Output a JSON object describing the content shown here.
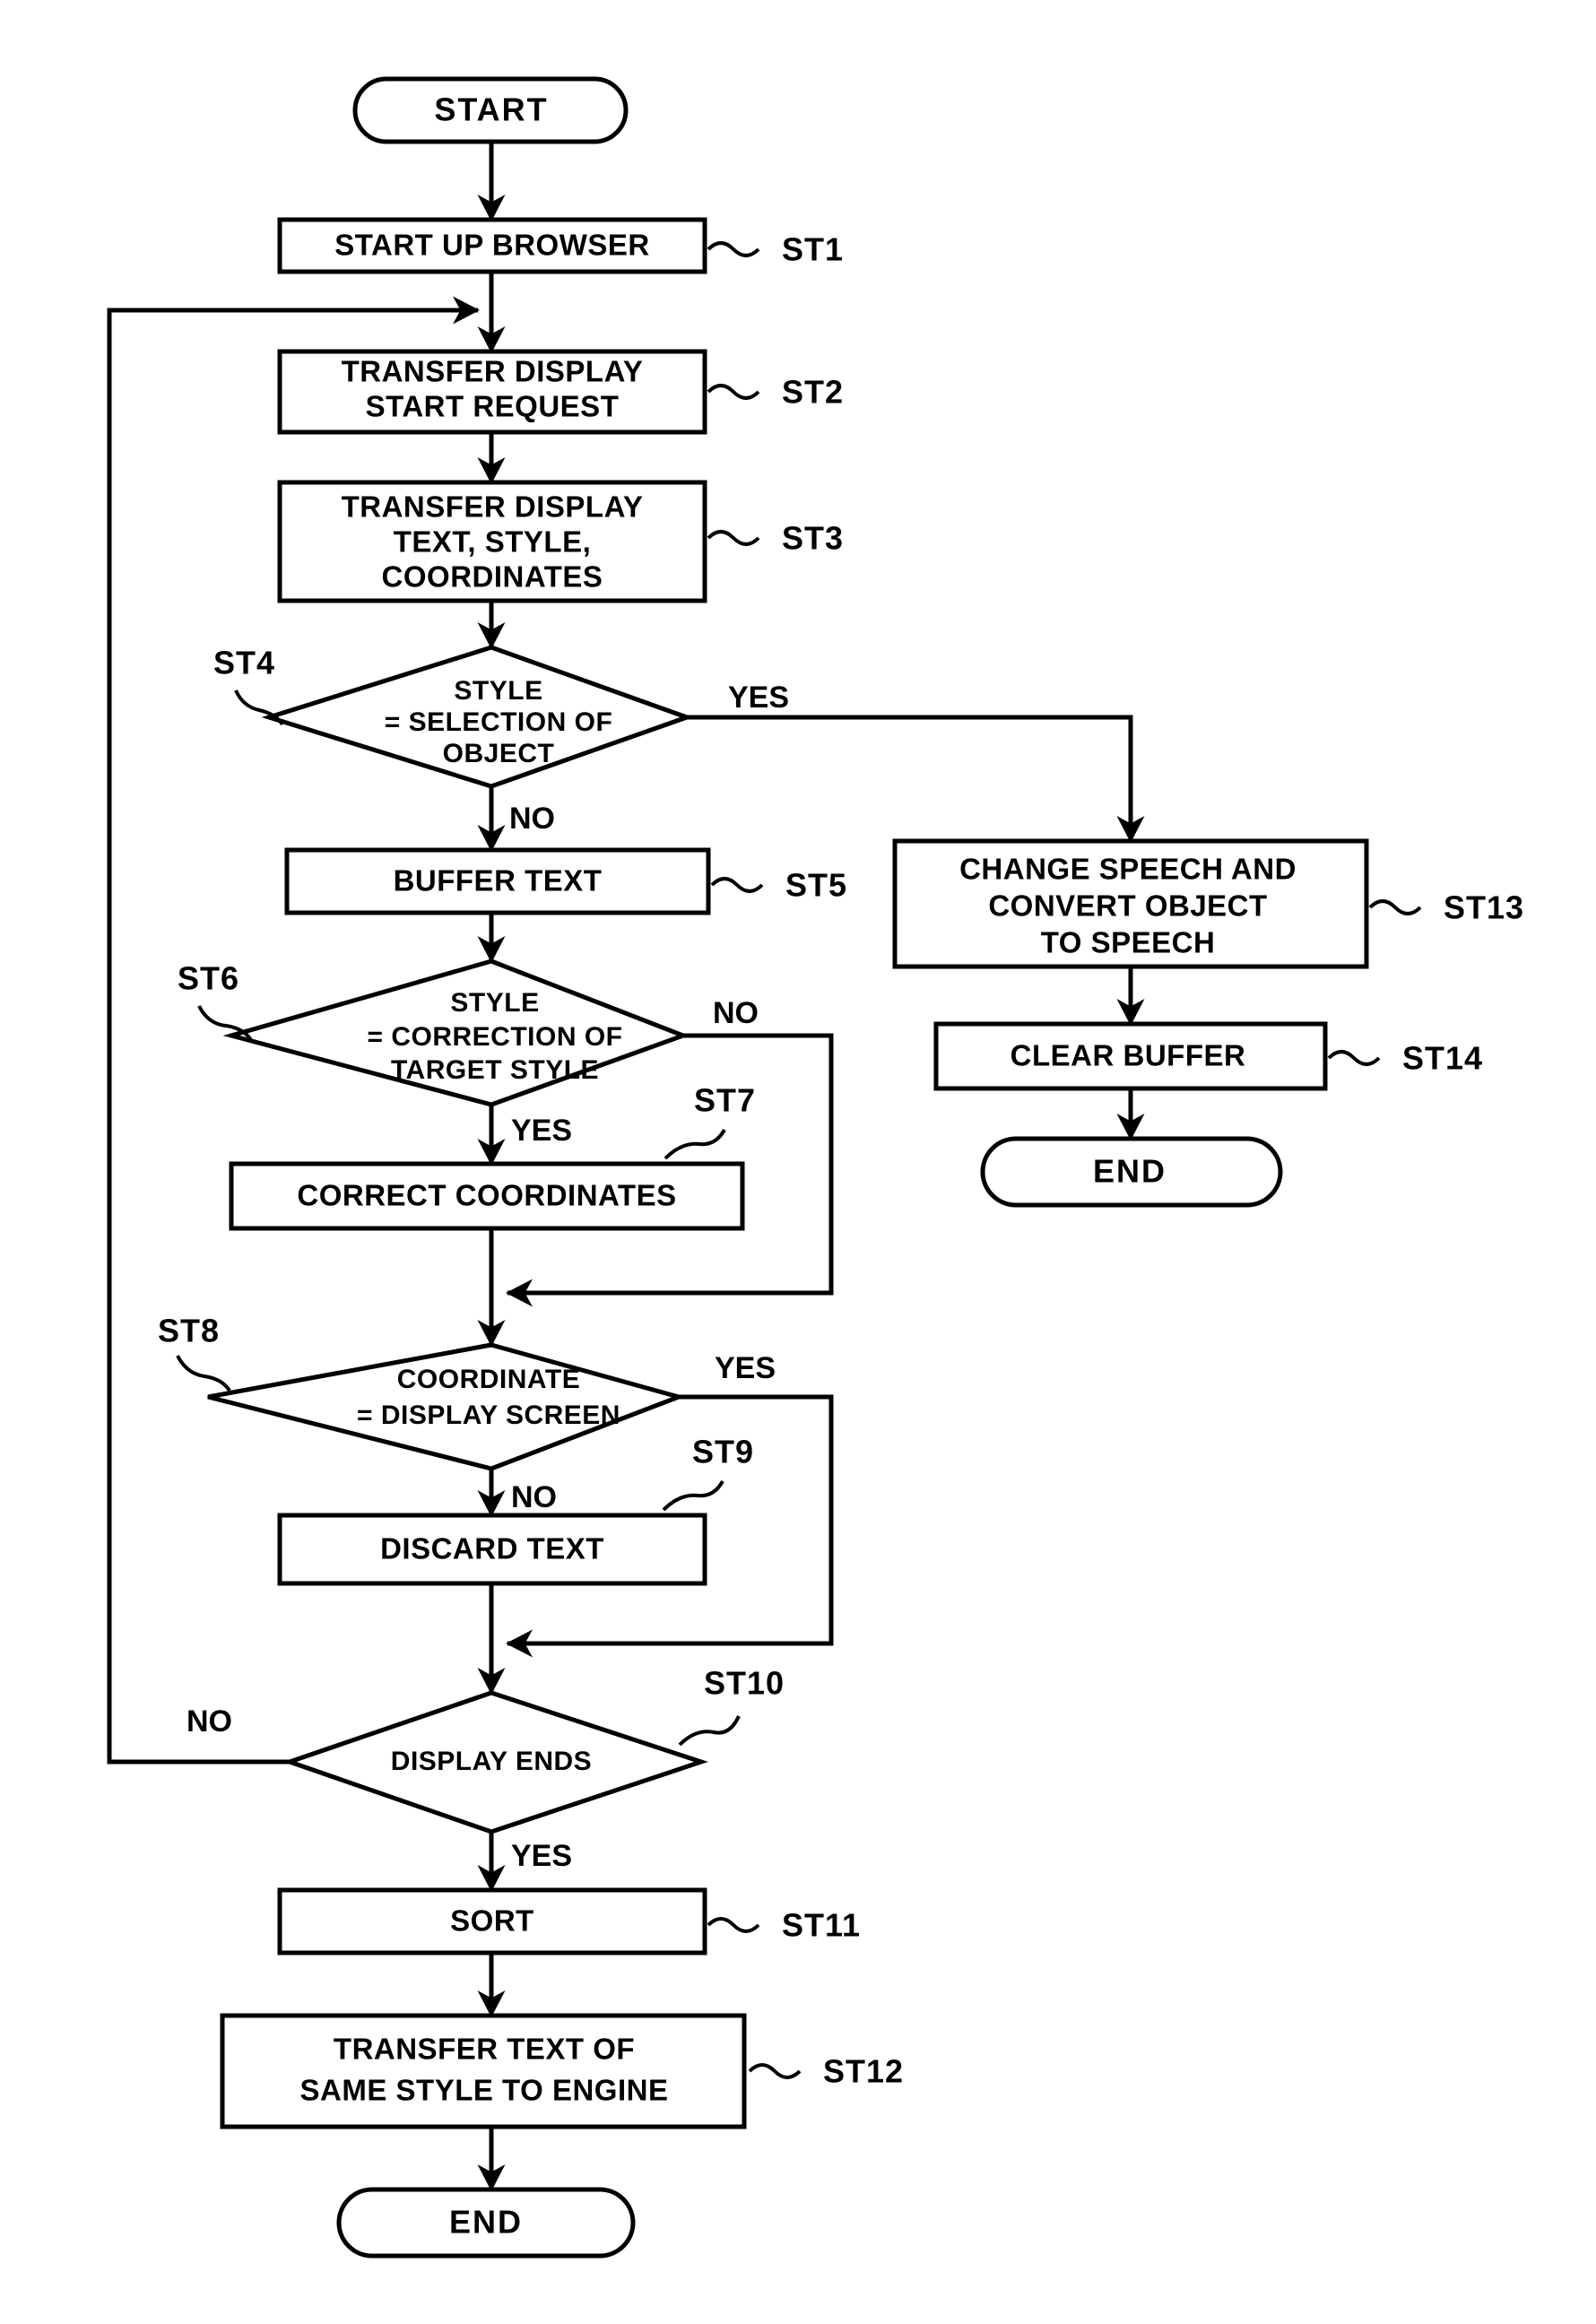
{
  "diagram": {
    "type": "flowchart",
    "orientation": "vertical",
    "terminals": {
      "start": "START",
      "end_main": "END",
      "end_branch": "END"
    },
    "branch_labels": {
      "yes": "YES",
      "no": "NO"
    },
    "nodes": [
      {
        "id": "start",
        "shape": "terminator",
        "text": "START",
        "step": ""
      },
      {
        "id": "st1",
        "shape": "process",
        "text": "START UP BROWSER",
        "step": "ST1"
      },
      {
        "id": "st2",
        "shape": "process",
        "line1": "TRANSFER DISPLAY",
        "line2": "START REQUEST",
        "step": "ST2"
      },
      {
        "id": "st3",
        "shape": "process",
        "line1": "TRANSFER DISPLAY",
        "line2": "TEXT, STYLE,",
        "line3": "COORDINATES",
        "step": "ST3"
      },
      {
        "id": "st4",
        "shape": "decision",
        "line1": "STYLE",
        "line2": "= SELECTION OF",
        "line3": "OBJECT",
        "step": "ST4",
        "yes_label": "YES",
        "no_label": "NO"
      },
      {
        "id": "st5",
        "shape": "process",
        "text": "BUFFER TEXT",
        "step": "ST5"
      },
      {
        "id": "st6",
        "shape": "decision",
        "line1": "STYLE",
        "line2": "= CORRECTION OF",
        "line3": "TARGET STYLE",
        "step": "ST6",
        "yes_label": "YES",
        "no_label": "NO"
      },
      {
        "id": "st7",
        "shape": "process",
        "text": "CORRECT COORDINATES",
        "step": "ST7"
      },
      {
        "id": "st8",
        "shape": "decision",
        "line1": "COORDINATE",
        "line2": "= DISPLAY SCREEN",
        "step": "ST8",
        "yes_label": "YES",
        "no_label": "NO"
      },
      {
        "id": "st9",
        "shape": "process",
        "text": "DISCARD TEXT",
        "step": "ST9"
      },
      {
        "id": "st10",
        "shape": "decision",
        "line1": "DISPLAY ENDS",
        "step": "ST10",
        "yes_label": "YES",
        "no_label": "NO"
      },
      {
        "id": "st11",
        "shape": "process",
        "text": "SORT",
        "step": "ST11"
      },
      {
        "id": "st12",
        "shape": "process",
        "line1": "TRANSFER TEXT OF",
        "line2": "SAME STYLE TO ENGINE",
        "step": "ST12"
      },
      {
        "id": "st13",
        "shape": "process",
        "line1": "CHANGE SPEECH AND",
        "line2": "CONVERT OBJECT",
        "line3": "TO SPEECH",
        "step": "ST13"
      },
      {
        "id": "st14",
        "shape": "process",
        "text": "CLEAR BUFFER",
        "step": "ST14"
      },
      {
        "id": "end_main",
        "shape": "terminator",
        "text": "END",
        "step": ""
      },
      {
        "id": "end_branch",
        "shape": "terminator",
        "text": "END",
        "step": ""
      }
    ],
    "colors": {
      "stroke": "#000000",
      "fill": "#ffffff",
      "background": "#ffffff"
    }
  }
}
